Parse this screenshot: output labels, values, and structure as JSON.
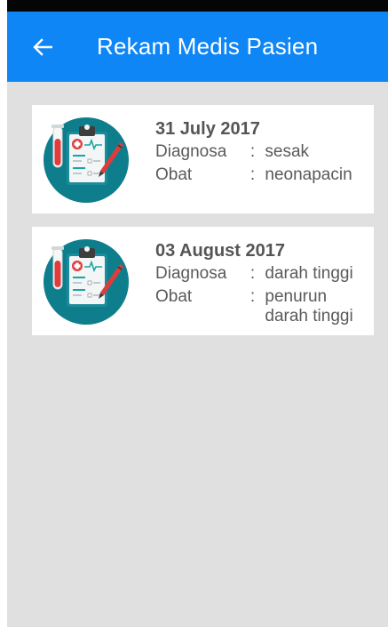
{
  "app_bar": {
    "title": "Rekam Medis Pasien",
    "back_icon": "arrow-left-icon",
    "background_color": "#0f86f5"
  },
  "records": [
    {
      "date": "31 July 2017",
      "diagnosa_label": "Diagnosa",
      "obat_label": "Obat",
      "separator": ":",
      "diagnosa": "sesak",
      "obat": "neonapacin",
      "icon": "medical-clipboard-icon"
    },
    {
      "date": "03 August 2017",
      "diagnosa_label": "Diagnosa",
      "obat_label": "Obat",
      "separator": ":",
      "diagnosa": "darah tinggi",
      "obat": "penurun darah tinggi",
      "icon": "medical-clipboard-icon"
    }
  ]
}
